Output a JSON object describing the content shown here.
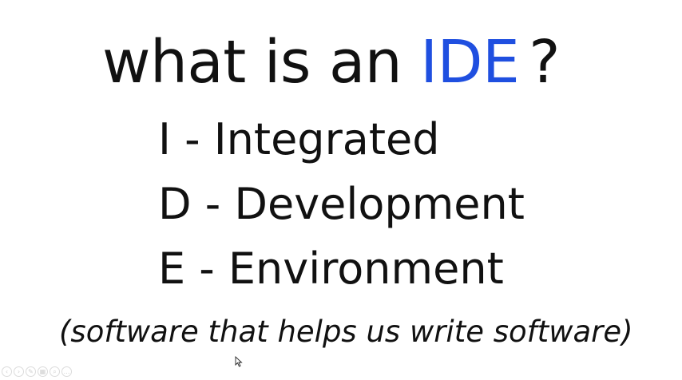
{
  "slide": {
    "title_prefix": "what is an ",
    "title_accent": "IDE",
    "title_suffix": "?",
    "lines": [
      "I - Integrated",
      "D - Development",
      "E - Environment"
    ],
    "subtitle": "(software that helps us write software)"
  },
  "colors": {
    "accent": "#1f4fe0",
    "text": "#111111",
    "background": "#ffffff"
  },
  "toolbar": {
    "icons": [
      "previous-icon",
      "next-icon",
      "pen-icon",
      "slides-icon",
      "zoom-icon",
      "more-icon"
    ],
    "glyphs": [
      "‹",
      "›",
      "✎",
      "▦",
      "⌕",
      "…"
    ]
  }
}
